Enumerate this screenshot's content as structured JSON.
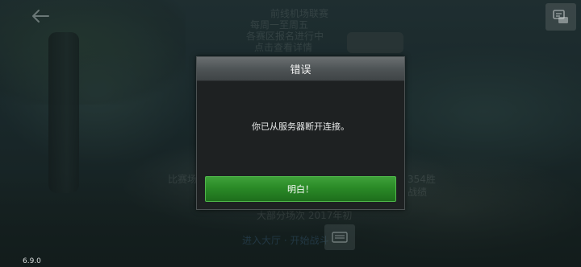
{
  "background": {
    "lines_top": [
      "前线机场联赛",
      "每周一至周五",
      "各赛区报名进行中",
      "点击查看详情"
    ],
    "line_left": "比赛场",
    "line_right_1": "354胜",
    "line_right_2": "战绩",
    "line_bottom": "大部分场次 2017年初",
    "bottom_link": "进入大厅 · 开始战斗"
  },
  "dialog": {
    "title": "错误",
    "message": "你已从服务器断开连接。",
    "confirm_label": "明白！"
  },
  "icons": {
    "back": "back-arrow-icon",
    "corner": "chat-menu-icon",
    "bottom": "garage-icon"
  },
  "colors": {
    "accent_green": "#2a8a27",
    "header_gray": "#4e5456",
    "dialog_bg": "#1e2122"
  },
  "version": "6.9.0"
}
